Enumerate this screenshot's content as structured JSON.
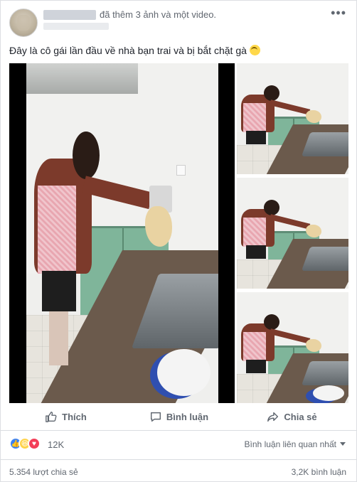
{
  "header": {
    "action_text": "đã thêm 3 ảnh và một video.",
    "more_icon": "ellipsis-icon"
  },
  "post": {
    "caption": "Đây là cô gái lần đầu về nhà bạn trai và bị bắt chặt gà",
    "emoji": "laughing-face-icon"
  },
  "media": {
    "video_count": 1,
    "photo_count": 3
  },
  "action_bar": {
    "like_label": "Thích",
    "comment_label": "Bình luận",
    "share_label": "Chia sẻ"
  },
  "reactions": {
    "types": [
      "like",
      "haha",
      "love"
    ],
    "count": "12K",
    "sort_label": "Bình luận liên quan nhất"
  },
  "footer": {
    "shares": "5.354 lượt chia sẻ",
    "comments": "3,2K bình luận"
  },
  "colors": {
    "like_blue": "#3b82f6",
    "love_red": "#f33e58",
    "haha_yellow": "#ffd24a",
    "secondary_text": "#606770"
  }
}
